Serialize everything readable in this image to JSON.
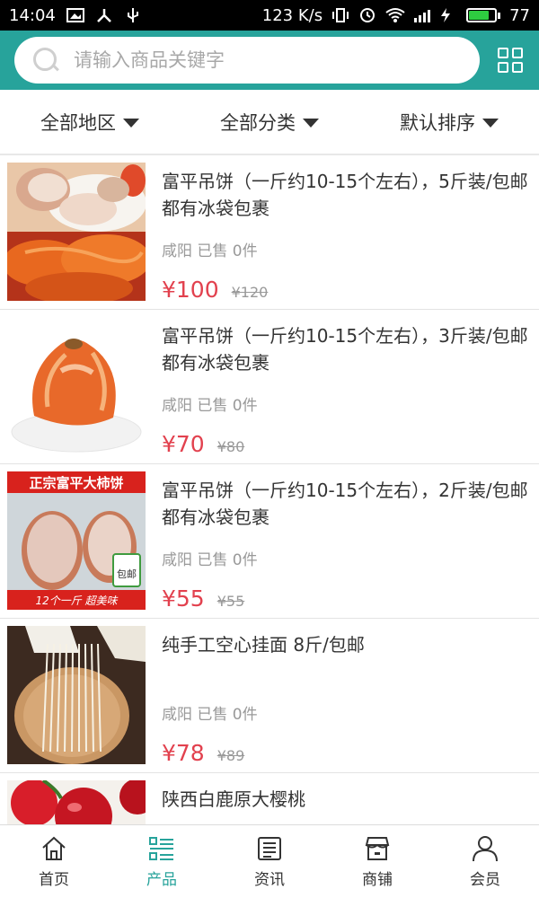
{
  "status_bar": {
    "time": "14:04",
    "speed": "123 K/s",
    "battery": "77",
    "battery_level": 0.77,
    "network": "4G"
  },
  "search": {
    "placeholder": "请输入商品关键字"
  },
  "filters": [
    {
      "label": "全部地区"
    },
    {
      "label": "全部分类"
    },
    {
      "label": "默认排序"
    }
  ],
  "products": [
    {
      "title": "富平吊饼（一斤约10-15个左右），5斤装/包邮都有冰袋包裹",
      "meta": "咸阳 已售 0件",
      "price": "¥100",
      "original_price": "¥120"
    },
    {
      "title": "富平吊饼（一斤约10-15个左右），3斤装/包邮都有冰袋包裹",
      "meta": "咸阳 已售 0件",
      "price": "¥70",
      "original_price": "¥80"
    },
    {
      "title": "富平吊饼（一斤约10-15个左右），2斤装/包邮都有冰袋包裹",
      "meta": "咸阳 已售 0件",
      "price": "¥55",
      "original_price": "¥55",
      "image_banner": "正宗富平大柿饼",
      "image_badge": "包邮",
      "image_caption": "12个一斤  超美味"
    },
    {
      "title": "纯手工空心挂面 8斤/包邮",
      "meta": "咸阳 已售 0件",
      "price": "¥78",
      "original_price": "¥89"
    },
    {
      "title": "陕西白鹿原大樱桃",
      "meta": "",
      "price": "",
      "original_price": ""
    }
  ],
  "tabs": [
    {
      "label": "首页",
      "icon": "home-icon"
    },
    {
      "label": "产品",
      "icon": "list-icon",
      "active": true
    },
    {
      "label": "资讯",
      "icon": "news-icon"
    },
    {
      "label": "商铺",
      "icon": "store-icon"
    },
    {
      "label": "会员",
      "icon": "user-icon"
    }
  ],
  "colors": {
    "accent": "#27a39b",
    "price": "#e2414e"
  }
}
